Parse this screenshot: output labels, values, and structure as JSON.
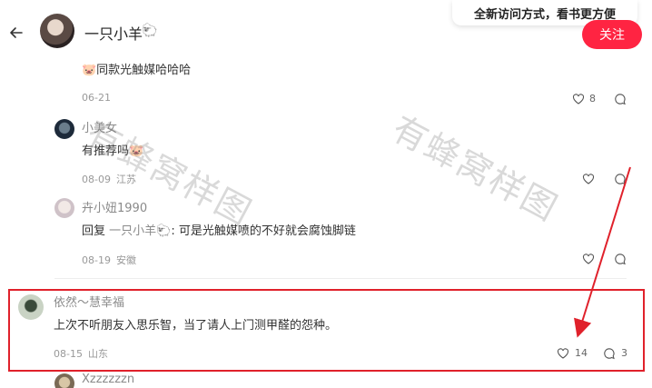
{
  "header": {
    "author_name": "一只小羊",
    "author_sheep": "🐑",
    "follow_label": "关注",
    "toast": "全新访问方式，看书更方便"
  },
  "comments": [
    {
      "text": "🐷同款光触媒哈哈哈",
      "date": "06-21",
      "location": "",
      "likes": "8"
    },
    {
      "user": "小美女",
      "text": "有推荐吗🐷",
      "date": "08-09",
      "location": "江苏"
    },
    {
      "user": "卉小妞1990",
      "reply_prefix": "回复",
      "reply_to": "一只小羊🐑",
      "text": ": 可是光触媒喷的不好就会腐蚀脚链",
      "date": "08-19",
      "location": "安徽"
    },
    {
      "user": "依然～慧幸福",
      "text": "上次不听朋友入思乐智，当了请人上门测甲醛的怨种。",
      "date": "08-15",
      "location": "山东",
      "likes": "14",
      "replies": "3"
    },
    {
      "user": "Xzzzzzzn"
    }
  ],
  "watermark": "有蜂窝样图",
  "colors": {
    "accent": "#ff2442",
    "highlight": "#e0212b"
  }
}
